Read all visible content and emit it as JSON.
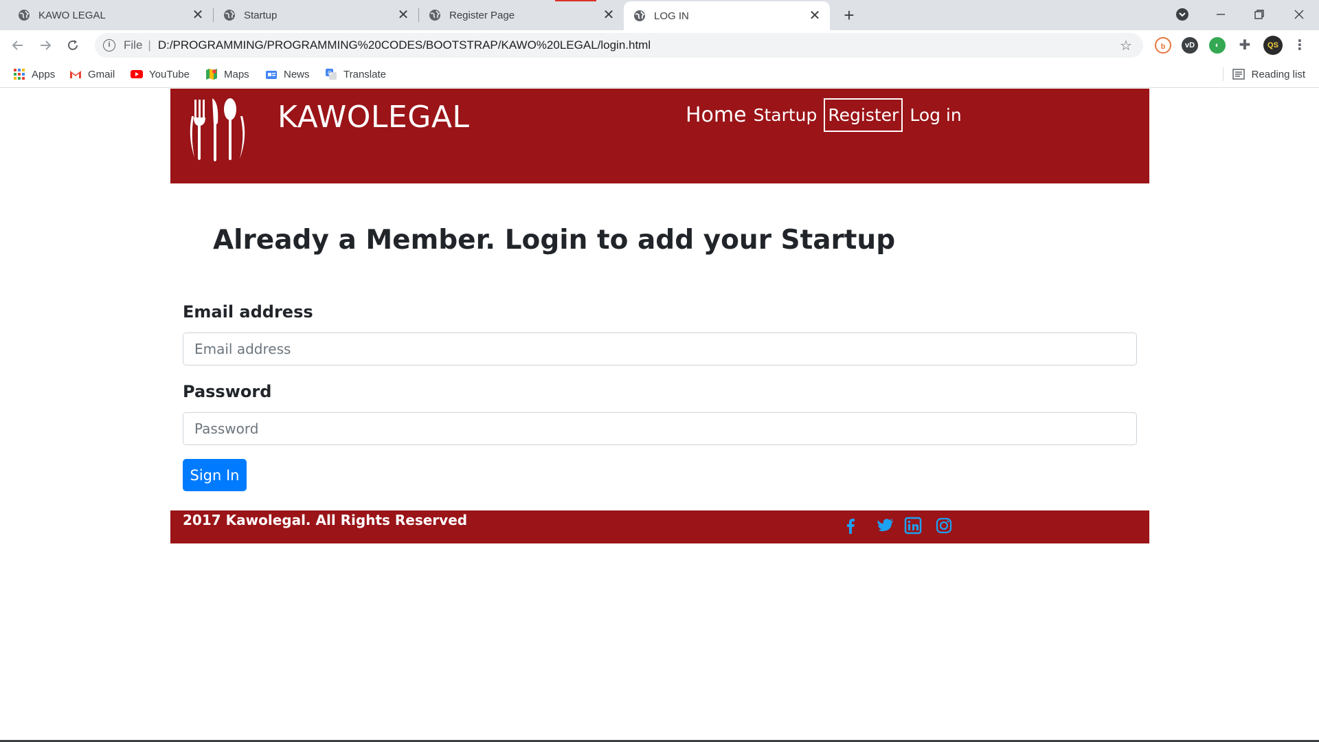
{
  "browser": {
    "tabs": [
      {
        "title": "KAWO LEGAL"
      },
      {
        "title": "Startup"
      },
      {
        "title": "Register Page"
      },
      {
        "title": "LOG IN"
      }
    ],
    "close_glyph": "✕",
    "new_tab_glyph": "+",
    "omnibox": {
      "scheme_label": "File",
      "separator": "|",
      "url": "D:/PROGRAMMING/PROGRAMMING%20CODES/BOOTSTRAP/KAWO%20LEGAL/login.html"
    },
    "bookmarks": [
      {
        "label": "Apps",
        "icon": "apps-grid-icon"
      },
      {
        "label": "Gmail",
        "icon": "gmail-icon"
      },
      {
        "label": "YouTube",
        "icon": "youtube-icon"
      },
      {
        "label": "Maps",
        "icon": "maps-icon"
      },
      {
        "label": "News",
        "icon": "news-icon"
      },
      {
        "label": "Translate",
        "icon": "translate-icon"
      }
    ],
    "reading_list": "Reading list"
  },
  "site": {
    "brand": "KAWOLEGAL",
    "nav": {
      "home": "Home",
      "startup": "Startup",
      "register": "Register",
      "login": "Log in"
    },
    "heading": "Already a Member. Login to add your Startup",
    "form": {
      "email_label": "Email address",
      "email_placeholder": "Email address",
      "password_label": "Password",
      "password_placeholder": "Password",
      "submit": "Sign In"
    },
    "footer": {
      "copyright": "2017 Kawolegal. All Rights Reserved",
      "social": [
        "facebook-icon",
        "twitter-icon",
        "linkedin-icon",
        "instagram-icon"
      ]
    }
  },
  "colors": {
    "brand_red": "#9a1418",
    "primary_blue": "#007bff",
    "social_blue": "#1da1f2"
  }
}
